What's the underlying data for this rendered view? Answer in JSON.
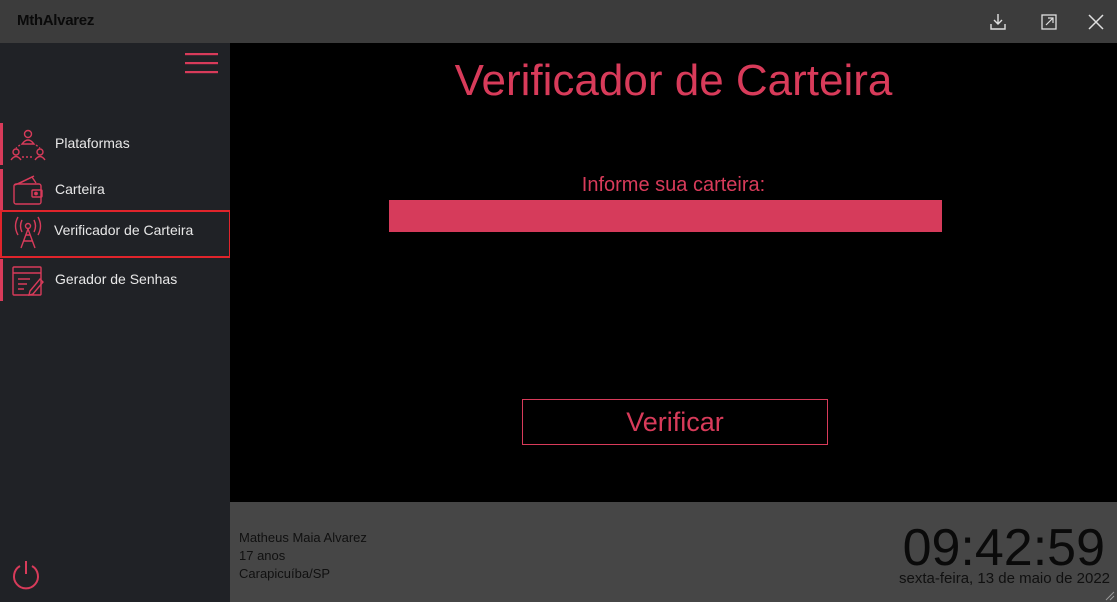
{
  "window": {
    "title": "MthAlvarez",
    "controls": [
      "download-icon",
      "maximize-icon",
      "close-icon"
    ]
  },
  "sidebar": {
    "items": [
      {
        "label": "Plataformas",
        "icon": "users-network-icon"
      },
      {
        "label": "Carteira",
        "icon": "wallet-icon"
      },
      {
        "label": "Verificador de Carteira",
        "icon": "antenna-icon",
        "active": true
      },
      {
        "label": "Gerador de Senhas",
        "icon": "password-form-icon"
      }
    ]
  },
  "main": {
    "title": "Verificador de Carteira",
    "prompt": "Informe sua carteira:",
    "input_value": "",
    "button_label": "Verificar"
  },
  "footer": {
    "user_name": "Matheus Maia Alvarez",
    "age": "17 anos",
    "location": "Carapicuíba/SP",
    "time": "09:42:59",
    "date": "sexta-feira, 13 de maio de 2022"
  },
  "colors": {
    "accent": "#d83b5a",
    "titlebar": "#3c3c3c",
    "sidebar": "#202226",
    "footer": "#464646",
    "active_border": "#e0242b"
  }
}
